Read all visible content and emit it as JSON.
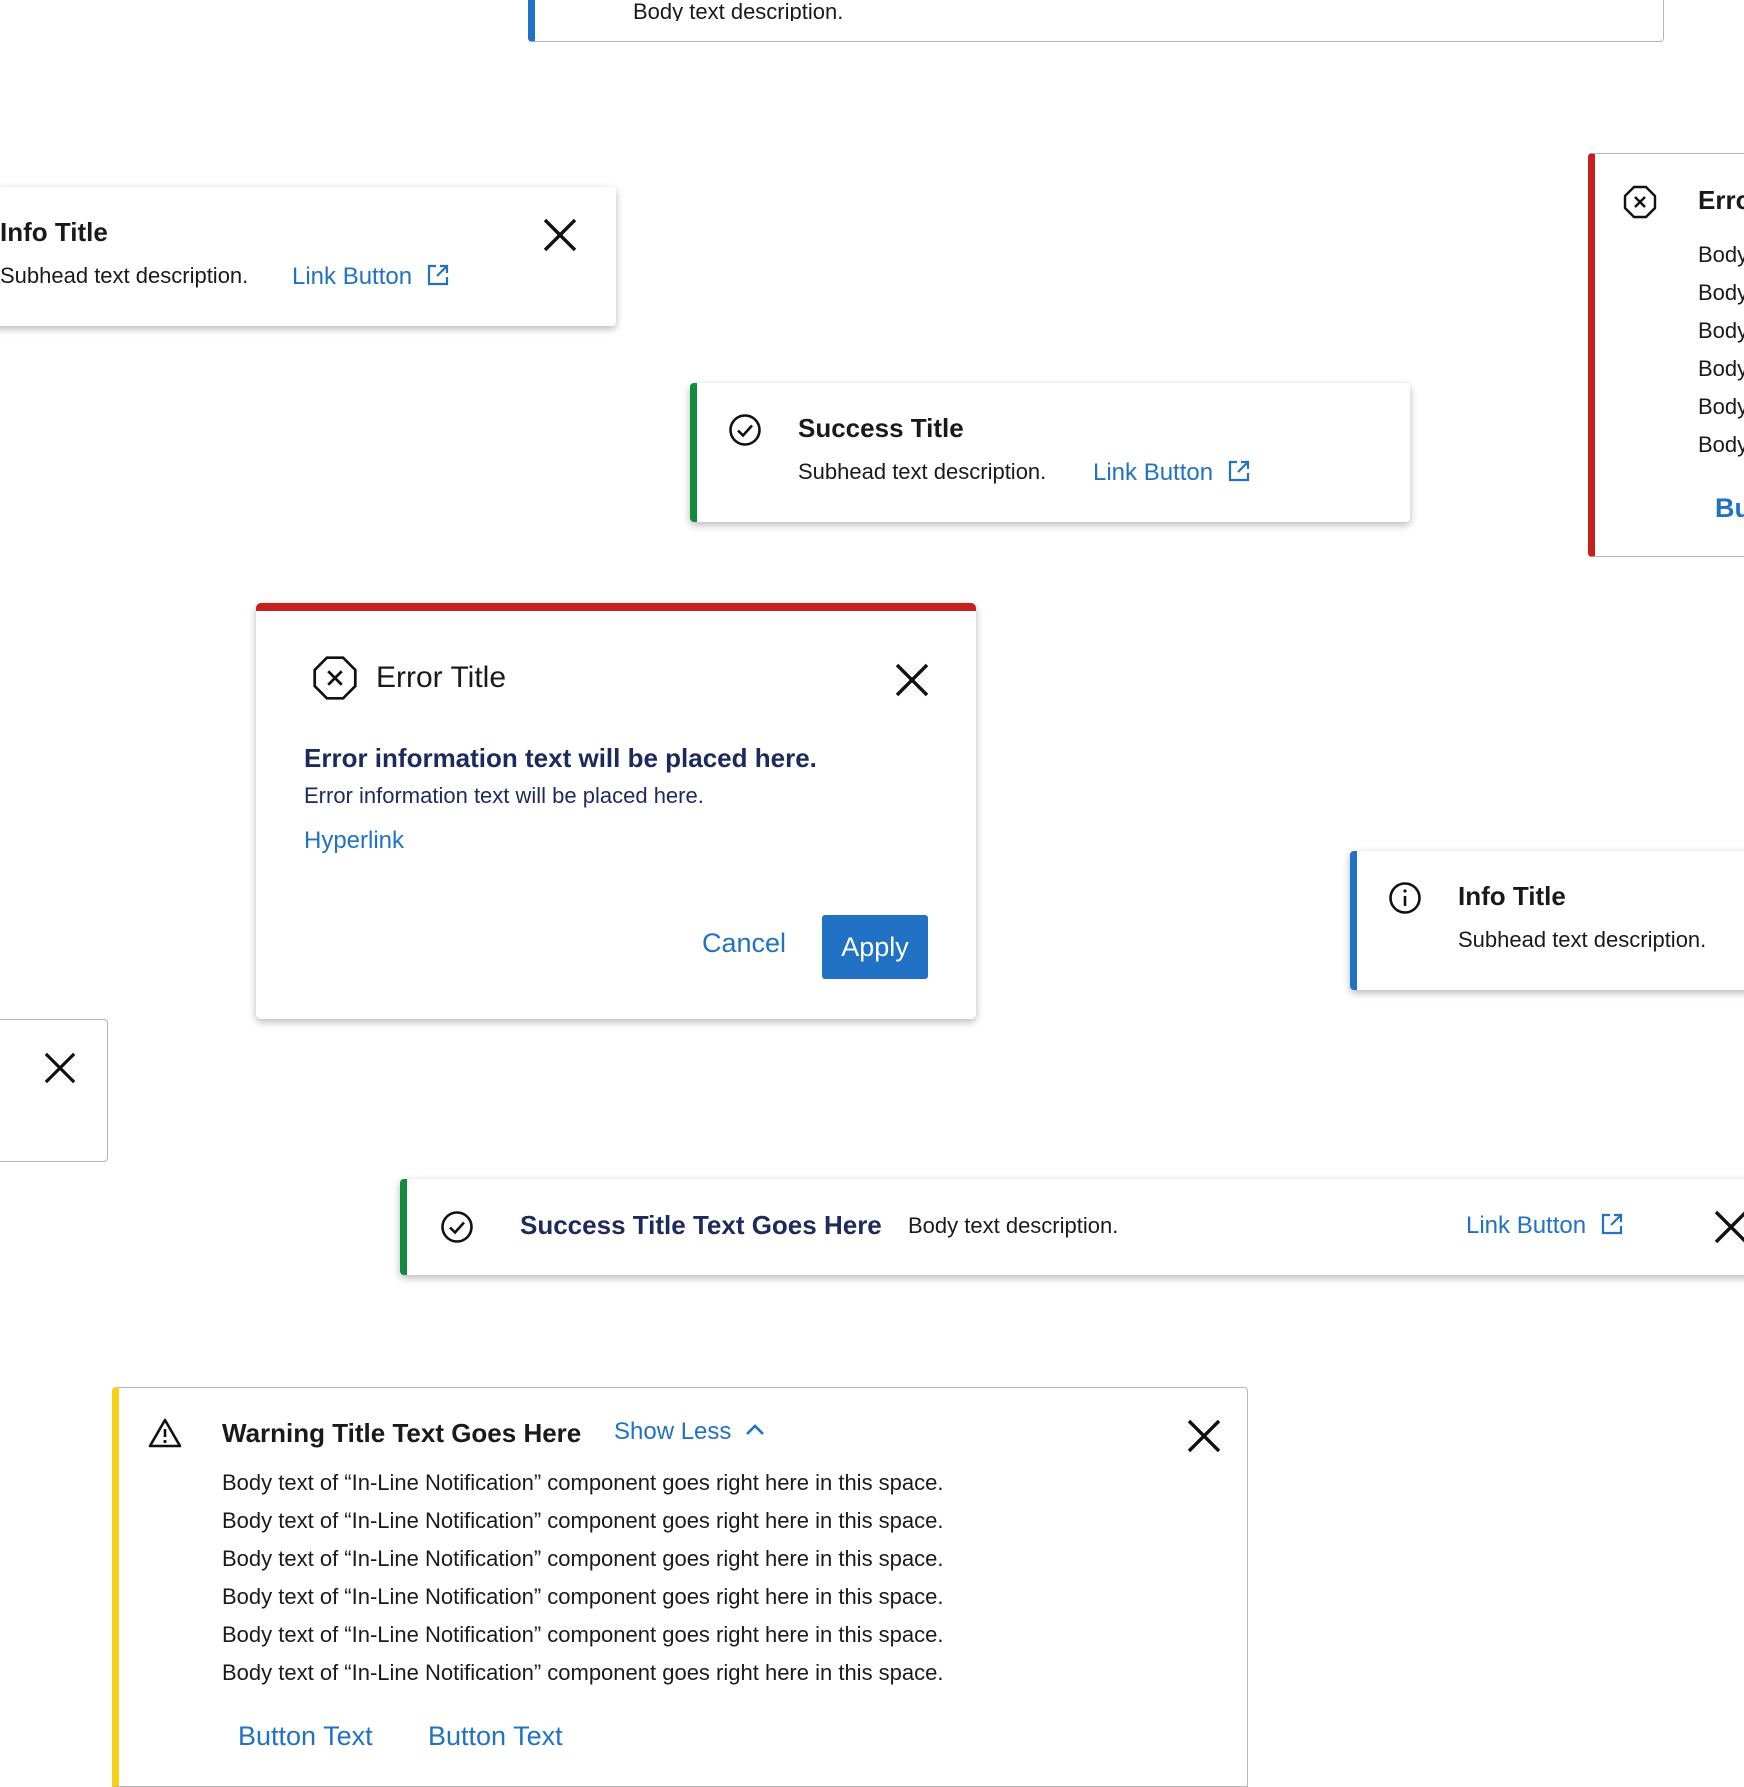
{
  "colors": {
    "info": "#2172c4",
    "success": "#138a3e",
    "error": "#c4211f",
    "warning": "#f7d117",
    "link": "#2172c4",
    "navy": "#1d2a5c"
  },
  "top_info_card": {
    "body": "Body text description."
  },
  "info_toast_left": {
    "title": "Info Title",
    "subhead": "Subhead text description.",
    "link": "Link Button",
    "icons": [
      "close-icon",
      "external-link-icon"
    ]
  },
  "success_toast": {
    "title": "Success Title",
    "subhead": "Subhead text description.",
    "link": "Link Button",
    "icons": [
      "check-circle-icon",
      "external-link-icon"
    ]
  },
  "error_inline_right": {
    "title": "Erro",
    "body_lines": [
      "Body",
      "Body",
      "Body",
      "Body",
      "Body",
      "Body"
    ],
    "button": "Bu",
    "icons": [
      "error-octagon-icon"
    ]
  },
  "error_modal": {
    "title": "Error Title",
    "headline": "Error information text will be placed here.",
    "detail": "Error information text will be placed here.",
    "hyperlink": "Hyperlink",
    "cancel": "Cancel",
    "apply": "Apply",
    "icons": [
      "error-octagon-icon",
      "close-icon"
    ]
  },
  "info_toast_right": {
    "title": "Info Title",
    "subhead": "Subhead text description.",
    "icons": [
      "info-circle-icon"
    ]
  },
  "success_banner": {
    "title": "Success Title Text Goes Here",
    "body": "Body text description.",
    "link": "Link Button",
    "icons": [
      "check-circle-icon",
      "external-link-icon",
      "close-icon"
    ]
  },
  "warning_inline": {
    "title": "Warning Title Text Goes Here",
    "toggle": "Show Less",
    "body_lines": [
      "Body text of “In-Line Notification” component goes right here in this space.",
      "Body text of “In-Line Notification” component goes right here in this space.",
      "Body text of “In-Line Notification” component goes right here in this space.",
      "Body text of “In-Line Notification” component goes right here in this space.",
      "Body text of “In-Line Notification” component goes right here in this space.",
      "Body text of “In-Line Notification” component goes right here in this space."
    ],
    "button_1": "Button Text",
    "button_2": "Button Text",
    "icons": [
      "warning-triangle-icon",
      "chevron-up-icon",
      "close-icon"
    ]
  }
}
